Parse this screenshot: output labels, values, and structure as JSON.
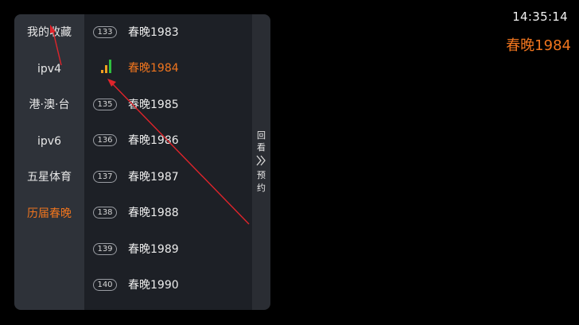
{
  "status": {
    "clock": "14:35:14",
    "now_playing": "春晚1984"
  },
  "groups": [
    {
      "label": "我的收藏",
      "active": false
    },
    {
      "label": "ipv4",
      "active": false
    },
    {
      "label": "港·澳·台",
      "active": false
    },
    {
      "label": "ipv6",
      "active": false
    },
    {
      "label": "五星体育",
      "active": false
    },
    {
      "label": "历届春晚",
      "active": true
    }
  ],
  "channels": [
    {
      "number": "133",
      "name": "春晚1983",
      "playing": false
    },
    {
      "number": "",
      "name": "春晚1984",
      "playing": true
    },
    {
      "number": "135",
      "name": "春晚1985",
      "playing": false
    },
    {
      "number": "136",
      "name": "春晚1986",
      "playing": false
    },
    {
      "number": "137",
      "name": "春晚1987",
      "playing": false
    },
    {
      "number": "138",
      "name": "春晚1988",
      "playing": false
    },
    {
      "number": "139",
      "name": "春晚1989",
      "playing": false
    },
    {
      "number": "140",
      "name": "春晚1990",
      "playing": false
    }
  ],
  "side_tab": {
    "top_chars": [
      "回",
      "看"
    ],
    "bottom_chars": [
      "预",
      "约"
    ],
    "icon": "double-chevron-right-icon"
  },
  "colors": {
    "accent": "#f0751e",
    "annotation": "#e0242b",
    "signal_low": "#f0a020",
    "signal_high": "#2fbf3f"
  }
}
